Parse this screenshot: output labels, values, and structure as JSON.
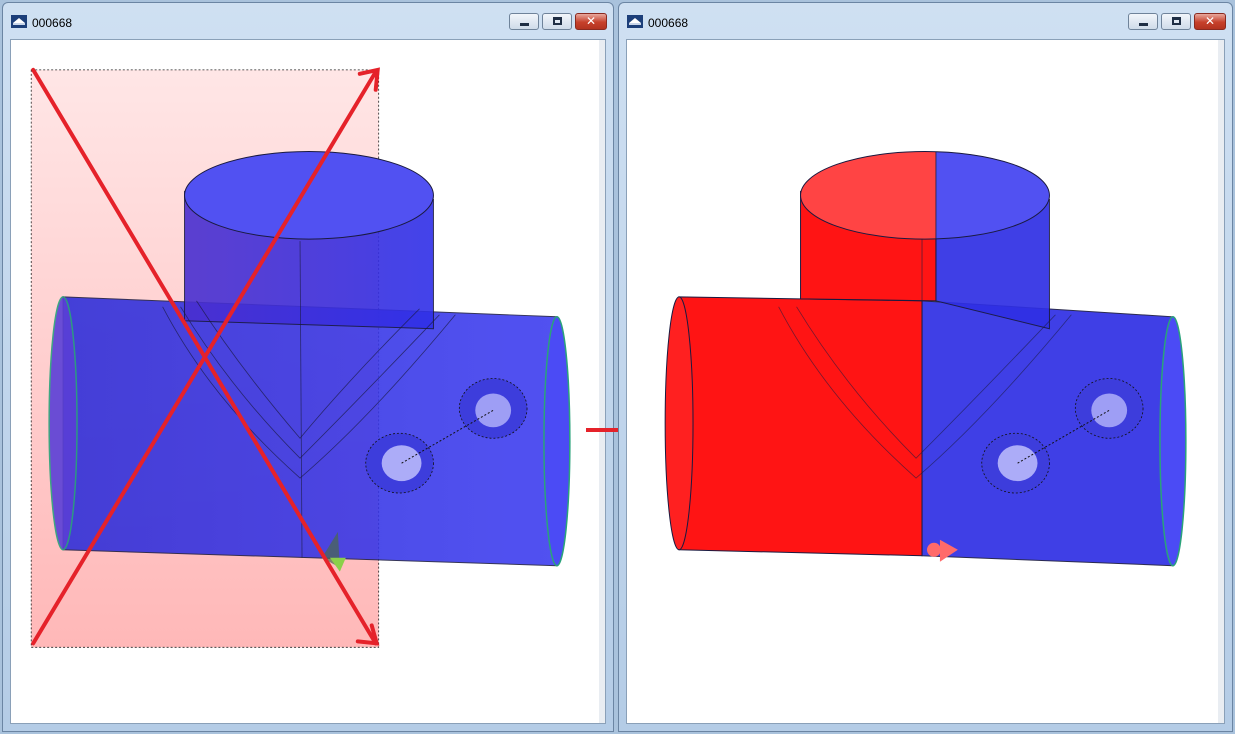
{
  "windows": [
    {
      "title": "000668"
    },
    {
      "title": "000668"
    }
  ],
  "icons": {
    "app": "app-logo-icon",
    "minimize": "minimize-icon",
    "maximize": "maximize-icon",
    "close": "close-icon"
  },
  "colors": {
    "model_blue": "#3a3ae0",
    "selection_fill": "#ffc6c6",
    "annotation_red": "#e5222a",
    "highlight_red": "#ff1414"
  }
}
